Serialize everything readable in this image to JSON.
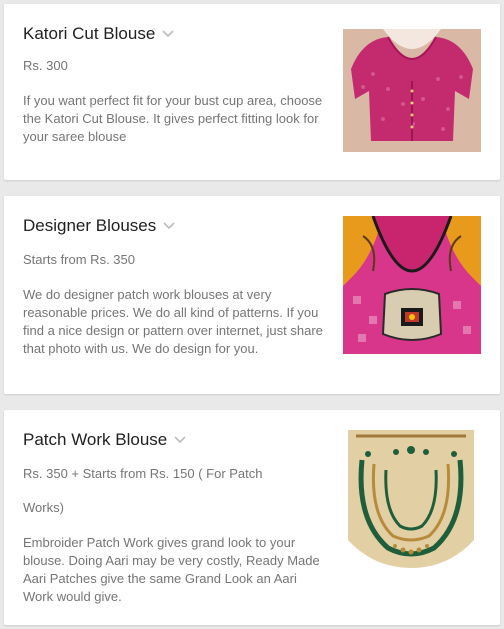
{
  "products": [
    {
      "title": "Katori Cut Blouse",
      "price": "Rs. 300",
      "description": "If you want perfect fit for your bust cup area, choose the Katori Cut Blouse. It gives perfect fitting look for your saree blouse"
    },
    {
      "title": "Designer Blouses",
      "price": "Starts from Rs. 350",
      "description": "We do designer patch work blouses at very reasonable prices. We do all kind of patterns. If you find a nice design or pattern over internet, just share that photo with us. We do design for you."
    },
    {
      "title": "Patch Work Blouse",
      "price": "Rs. 350 + Starts from Rs. 150 ( For Patch",
      "price_cont": "Works)",
      "description": "Embroider Patch Work gives grand look to your blouse. Doing Aari may be very costly, Ready Made Aari Patches give the same Grand Look an Aari Work would give."
    }
  ],
  "colors": {
    "background": "#e9e9e9",
    "card": "#ffffff",
    "title": "#212121",
    "text": "#757575",
    "chevron": "#bdbdbd"
  },
  "icons": [
    "chevron-down-icon"
  ]
}
